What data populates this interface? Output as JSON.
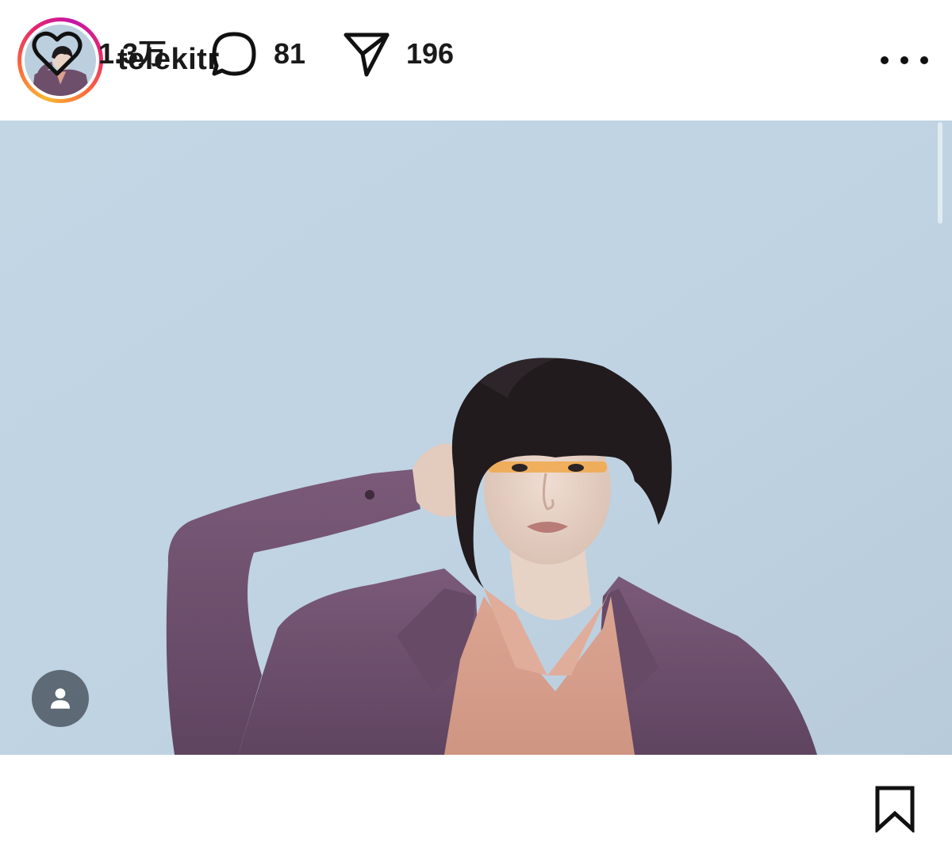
{
  "header": {
    "username": "telekitr",
    "more_icon": "more-horizontal-icon"
  },
  "media": {
    "tag_icon": "person-tag-icon",
    "background_color": "#bfd2e1"
  },
  "actions": {
    "like": {
      "icon": "heart-icon",
      "count": "1.3万"
    },
    "comment": {
      "icon": "comment-bubble-icon",
      "count": "81"
    },
    "share": {
      "icon": "paper-plane-icon",
      "count": "196"
    },
    "save": {
      "icon": "bookmark-icon"
    }
  },
  "colors": {
    "story_ring_start": "#f7b733",
    "story_ring_end": "#c416a8",
    "jacket": "#6e4f6b",
    "shirt": "#d9a08e"
  }
}
